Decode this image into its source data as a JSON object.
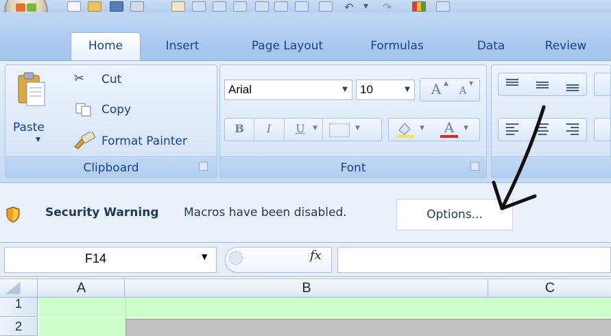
{
  "tabs": [
    "Home",
    "Insert",
    "Page Layout",
    "Formulas",
    "Data",
    "Review"
  ],
  "clipboard": {
    "paste_label": "Paste",
    "cut_label": "Cut",
    "copy_label": "Copy",
    "format_painter_label": "Format Painter",
    "group_label": "Clipboard"
  },
  "font": {
    "font_name": "Arial",
    "font_size": "10",
    "group_label": "Font",
    "bold": "B",
    "italic": "I",
    "underline": "U",
    "grow": "A",
    "shrink": "A",
    "font_color": "A"
  },
  "security": {
    "title": "Security Warning",
    "message": "Macros have been disabled.",
    "options_label": "Options..."
  },
  "formula_bar": {
    "name_box": "F14",
    "fx_label": "fx",
    "formula_value": ""
  },
  "grid": {
    "columns": [
      "A",
      "B",
      "C"
    ],
    "rows": [
      "1",
      "2"
    ]
  },
  "colors": {
    "ribbon_blue": "#bfd7f4",
    "row_fill_green": "#ccffcc",
    "cell_fill_gray": "#c0c0c0"
  },
  "icons": [
    "office-button-icon",
    "save-icon",
    "undo-icon",
    "redo-icon",
    "cut-icon",
    "copy-icon",
    "format-painter-icon",
    "paste-icon",
    "security-shield-icon",
    "fx-icon"
  ]
}
